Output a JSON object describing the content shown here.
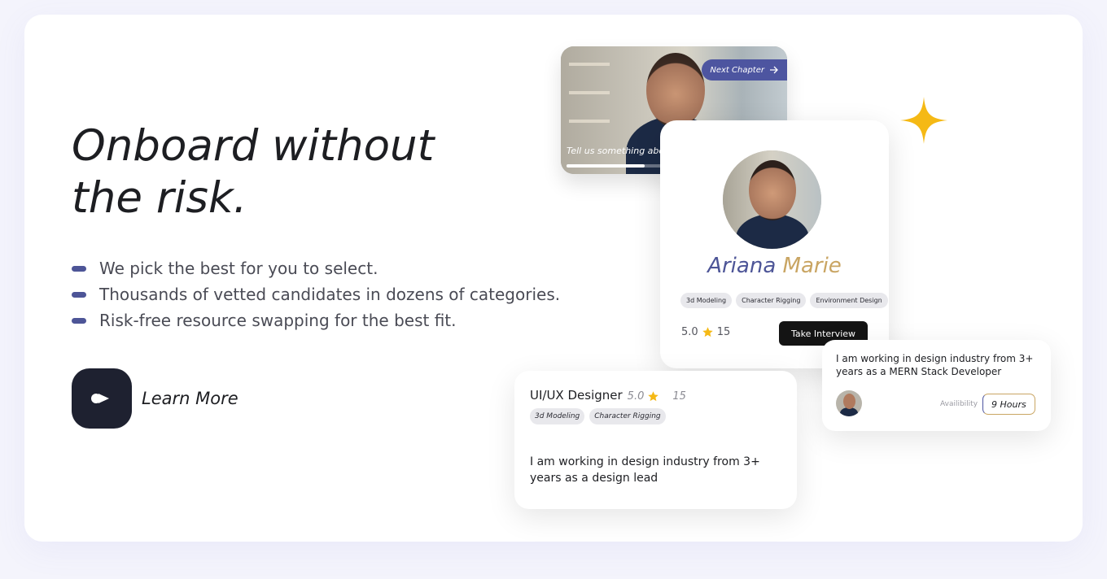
{
  "hero": {
    "headline_line1": "Onboard without",
    "headline_line2": "the risk.",
    "bullets": [
      "We pick the best for you to select.",
      "Thousands of vetted candidates in dozens of categories.",
      "Risk-free resource swapping for the best fit."
    ],
    "cta_label": "Learn More"
  },
  "video_card": {
    "next_chapter_label": "Next Chapter",
    "caption": "Tell us something abo",
    "progress": 0.4
  },
  "profile_card": {
    "first_name": "Ariana",
    "last_name": "Marie",
    "skills": [
      "3d Modeling",
      "Character Rigging",
      "Environment Design"
    ],
    "rating": "5.0",
    "reviews": "15",
    "action_label": "Take Interview"
  },
  "designer_card": {
    "role": "UI/UX Designer",
    "rating": "5.0",
    "reviews": "15",
    "skills": [
      "3d Modeling",
      "Character Rigging"
    ],
    "description": "I am working in design industry from 3+ years as a design lead"
  },
  "mern_card": {
    "description": "I am working in design industry from 3+ years as a MERN Stack Developer",
    "availability_label": "Availibility",
    "hours": "9 Hours"
  },
  "colors": {
    "accent": "#4d5597",
    "gold": "#c9a563",
    "star": "#f5b915",
    "dark": "#141414"
  }
}
